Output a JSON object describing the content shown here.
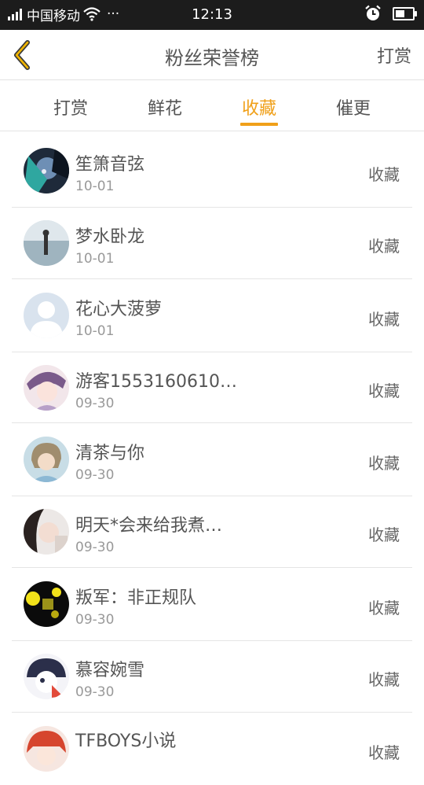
{
  "status_bar": {
    "carrier": "中国移动",
    "dots": "···",
    "time": "12:13",
    "battery_level": 0.55
  },
  "header": {
    "title": "粉丝荣誉榜",
    "action": "打赏"
  },
  "tabs": [
    {
      "label": "打赏",
      "active": false
    },
    {
      "label": "鲜花",
      "active": false
    },
    {
      "label": "收藏",
      "active": true
    },
    {
      "label": "催更",
      "active": false
    }
  ],
  "list": [
    {
      "name": "笙箫音弦",
      "date": "10-01",
      "action": "收藏"
    },
    {
      "name": "梦水卧龙",
      "date": "10-01",
      "action": "收藏"
    },
    {
      "name": "花心大菠萝",
      "date": "10-01",
      "action": "收藏"
    },
    {
      "name": "游客1553160610…",
      "date": "09-30",
      "action": "收藏"
    },
    {
      "name": "清茶与你",
      "date": "09-30",
      "action": "收藏"
    },
    {
      "name": "明天*会来给我煮…",
      "date": "09-30",
      "action": "收藏"
    },
    {
      "name": "叛军：非正规队",
      "date": "09-30",
      "action": "收藏"
    },
    {
      "name": "慕容婉雪",
      "date": "09-30",
      "action": "收藏"
    },
    {
      "name": "TFBOYS小说",
      "date": "",
      "action": "收藏"
    }
  ],
  "colors": {
    "accent": "#f0a019",
    "status_bar": "#1c1c1c",
    "text": "#555555",
    "subtext": "#999999"
  }
}
